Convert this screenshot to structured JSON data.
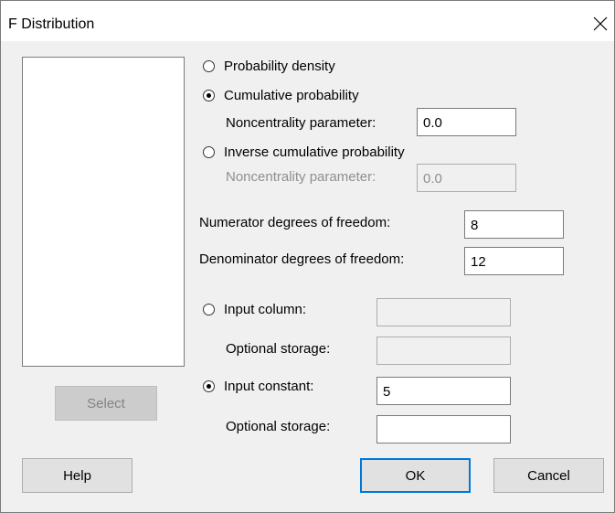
{
  "window": {
    "title": "F Distribution"
  },
  "variable_list": {
    "items": []
  },
  "select_button": "Select",
  "options": {
    "probability_density": "Probability density",
    "cumulative_probability": "Cumulative probability",
    "cumulative_noncentrality_label": "Noncentrality parameter:",
    "cumulative_noncentrality_value": "0.0",
    "inverse_cumulative": "Inverse cumulative probability",
    "inverse_noncentrality_label": "Noncentrality parameter:",
    "inverse_noncentrality_value": "0.0",
    "selected": "cumulative_probability"
  },
  "degrees": {
    "numerator_label": "Numerator degrees of freedom:",
    "numerator_value": "8",
    "denominator_label": "Denominator degrees of freedom:",
    "denominator_value": "12"
  },
  "input": {
    "column_label": "Input column:",
    "column_value": "",
    "column_storage_label": "Optional storage:",
    "column_storage_value": "",
    "constant_label": "Input constant:",
    "constant_value": "5",
    "constant_storage_label": "Optional storage:",
    "constant_storage_value": "",
    "selected": "input_constant"
  },
  "buttons": {
    "help": "Help",
    "ok": "OK",
    "cancel": "Cancel"
  }
}
